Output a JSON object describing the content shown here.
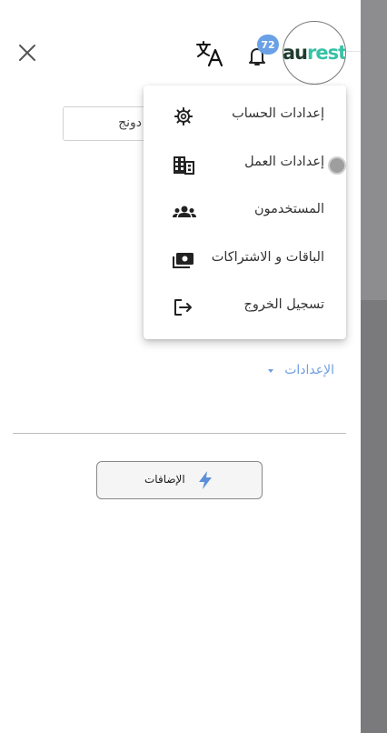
{
  "header": {
    "close_icon": "close-icon",
    "translate_icon": "translate-icon",
    "bell_icon": "bell-icon",
    "notification_count": "72",
    "logo": {
      "part1": "au",
      "part2": "rest"
    }
  },
  "search_field_fragment": "دونج",
  "account_menu": {
    "items": [
      {
        "label": "إعدادات الحساب",
        "icon": "gear-icon"
      },
      {
        "label": "إعدادات العمل",
        "icon": "building-icon"
      },
      {
        "label": "المستخدمون",
        "icon": "users-icon"
      },
      {
        "label": "الباقات و الاشتراكات",
        "icon": "cash-icon"
      },
      {
        "label": "تسجيل الخروج",
        "icon": "logout-icon"
      }
    ]
  },
  "sidebar": {
    "settings_label": "الإعدادات",
    "addons_label": "الإضافات",
    "addons_icon": "lightning-icon"
  },
  "colors": {
    "accent_blue": "#6f9fe0",
    "badge_blue": "#6aa1e6",
    "logo_dark": "#1f3b2f",
    "logo_teal": "#37c2a6",
    "overlay_gray": "#7a7a7c"
  }
}
